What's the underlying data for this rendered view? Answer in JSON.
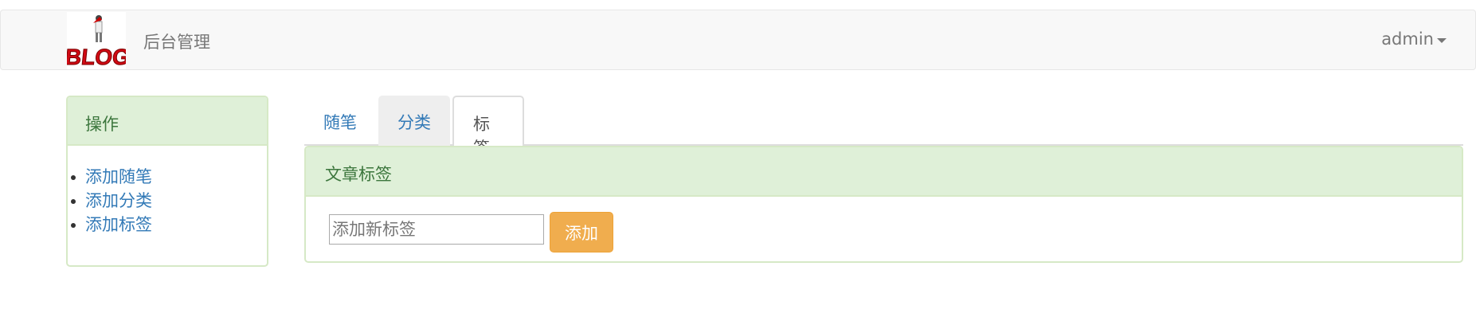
{
  "navbar": {
    "logo_alt": "BLOG",
    "brand": "后台管理",
    "user": "admin"
  },
  "sidebar": {
    "title": "操作",
    "items": [
      {
        "label": "添加随笔"
      },
      {
        "label": "添加分类"
      },
      {
        "label": "添加标签"
      }
    ]
  },
  "tabs": [
    {
      "label": "随笔",
      "active": false
    },
    {
      "label": "分类",
      "active": false
    },
    {
      "label": "标签",
      "active": true
    }
  ],
  "content": {
    "title": "文章标签",
    "input_placeholder": "添加新标签",
    "add_button": "添加"
  },
  "colors": {
    "panel_success_bg": "#dff0d8",
    "panel_success_border": "#d6e9c6",
    "panel_success_text": "#3c763d",
    "link": "#337ab7",
    "warning_button": "#f0ad4e"
  }
}
